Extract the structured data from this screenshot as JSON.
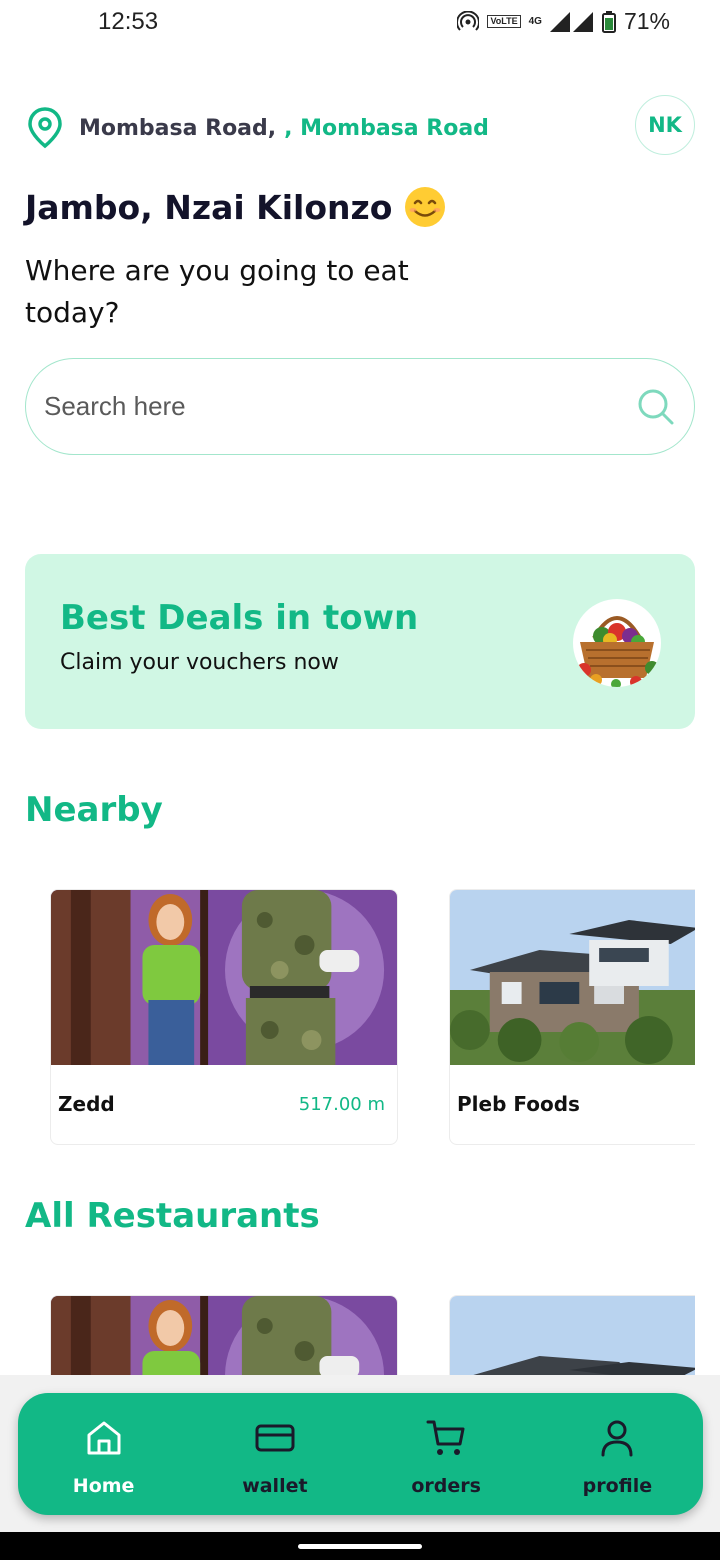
{
  "status_bar": {
    "time": "12:53",
    "volte_label": "VoLTE",
    "network_label": "4G",
    "battery_percent": "71%"
  },
  "header": {
    "location_primary": "Mombasa Road,",
    "location_secondary": ", Mombasa Road",
    "avatar_initials": "NK",
    "greeting": "Jambo, Nzai Kilonzo",
    "subheading": "Where are you going to eat today?"
  },
  "search": {
    "placeholder": "Search here",
    "value": ""
  },
  "deals": {
    "title": "Best Deals in town",
    "subtitle": "Claim your vouchers now"
  },
  "nearby": {
    "title": "Nearby",
    "cards": [
      {
        "name": "Zedd",
        "distance": "517.00 m",
        "image": "illustration"
      },
      {
        "name": "Pleb Foods",
        "distance": "",
        "image": "house"
      }
    ]
  },
  "all_restaurants": {
    "title": "All Restaurants",
    "cards": [
      {
        "image": "illustration"
      },
      {
        "image": "house"
      }
    ]
  },
  "bottom_nav": {
    "items": [
      {
        "label": "Home",
        "icon": "home-icon",
        "active": true
      },
      {
        "label": "wallet",
        "icon": "wallet-icon",
        "active": false
      },
      {
        "label": "orders",
        "icon": "cart-icon",
        "active": false
      },
      {
        "label": "profile",
        "icon": "profile-icon",
        "active": false
      }
    ]
  },
  "colors": {
    "accent": "#12b886",
    "banner_bg": "#d0f7e4",
    "text_dark": "#13132a"
  }
}
